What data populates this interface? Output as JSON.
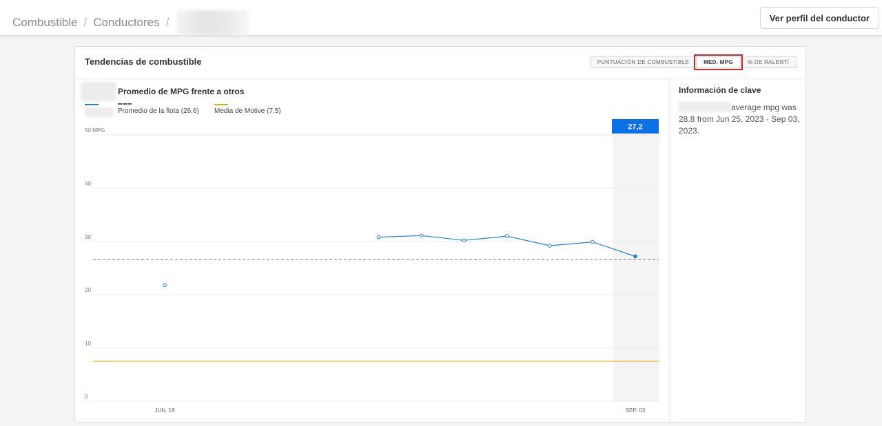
{
  "breadcrumb": {
    "items": [
      "Combustible",
      "Conductores"
    ],
    "separator": "/"
  },
  "header": {
    "profile_button": "Ver perfil del conductor"
  },
  "card": {
    "title": "Tendencias de combustible",
    "tabs": [
      {
        "label": "PUNTUACIÓN DE COMBUSTIBLE",
        "active": false
      },
      {
        "label": "MED. MPG",
        "active": true
      },
      {
        "label": "% DE RALENTÍ",
        "active": false
      }
    ]
  },
  "chart_data": {
    "type": "line",
    "title": "Promedio de MPG frente a otros",
    "yaxis_label": "50 MPG",
    "ylim": [
      0,
      50
    ],
    "yticks": [
      "0",
      "10",
      "20",
      "30",
      "40",
      "50 MPG"
    ],
    "xtick_labels": [
      "JUN. 18",
      "SEP. 03"
    ],
    "x": [
      "JUN. 18",
      "",
      "",
      "",
      "",
      "",
      "",
      "",
      "",
      "",
      "",
      "SEP. 03"
    ],
    "series": [
      {
        "name": "",
        "color": "#1f7fe6",
        "values": [
          21.8,
          null,
          null,
          null,
          null,
          30.8,
          31.1,
          30.2,
          31.0,
          29.2,
          29.9,
          27.2
        ]
      }
    ],
    "reference_lines": [
      {
        "name": "Promedio de la flota (26.6)",
        "value": 26.6,
        "color": "#999999",
        "style": "dashed"
      },
      {
        "name": "Media de Motive (7.5)",
        "value": 7.5,
        "color": "#e0a81b",
        "style": "solid"
      }
    ],
    "highlight": {
      "index": 11,
      "label": "27,2",
      "color": "#0c71e8"
    }
  },
  "info": {
    "title": "Información de clave",
    "text": "average mpg was 28.8 from Jun 25, 2023 - Sep 03, 2023."
  },
  "colors": {
    "accent": "#0c71e8",
    "active_outline": "#d0262a"
  }
}
